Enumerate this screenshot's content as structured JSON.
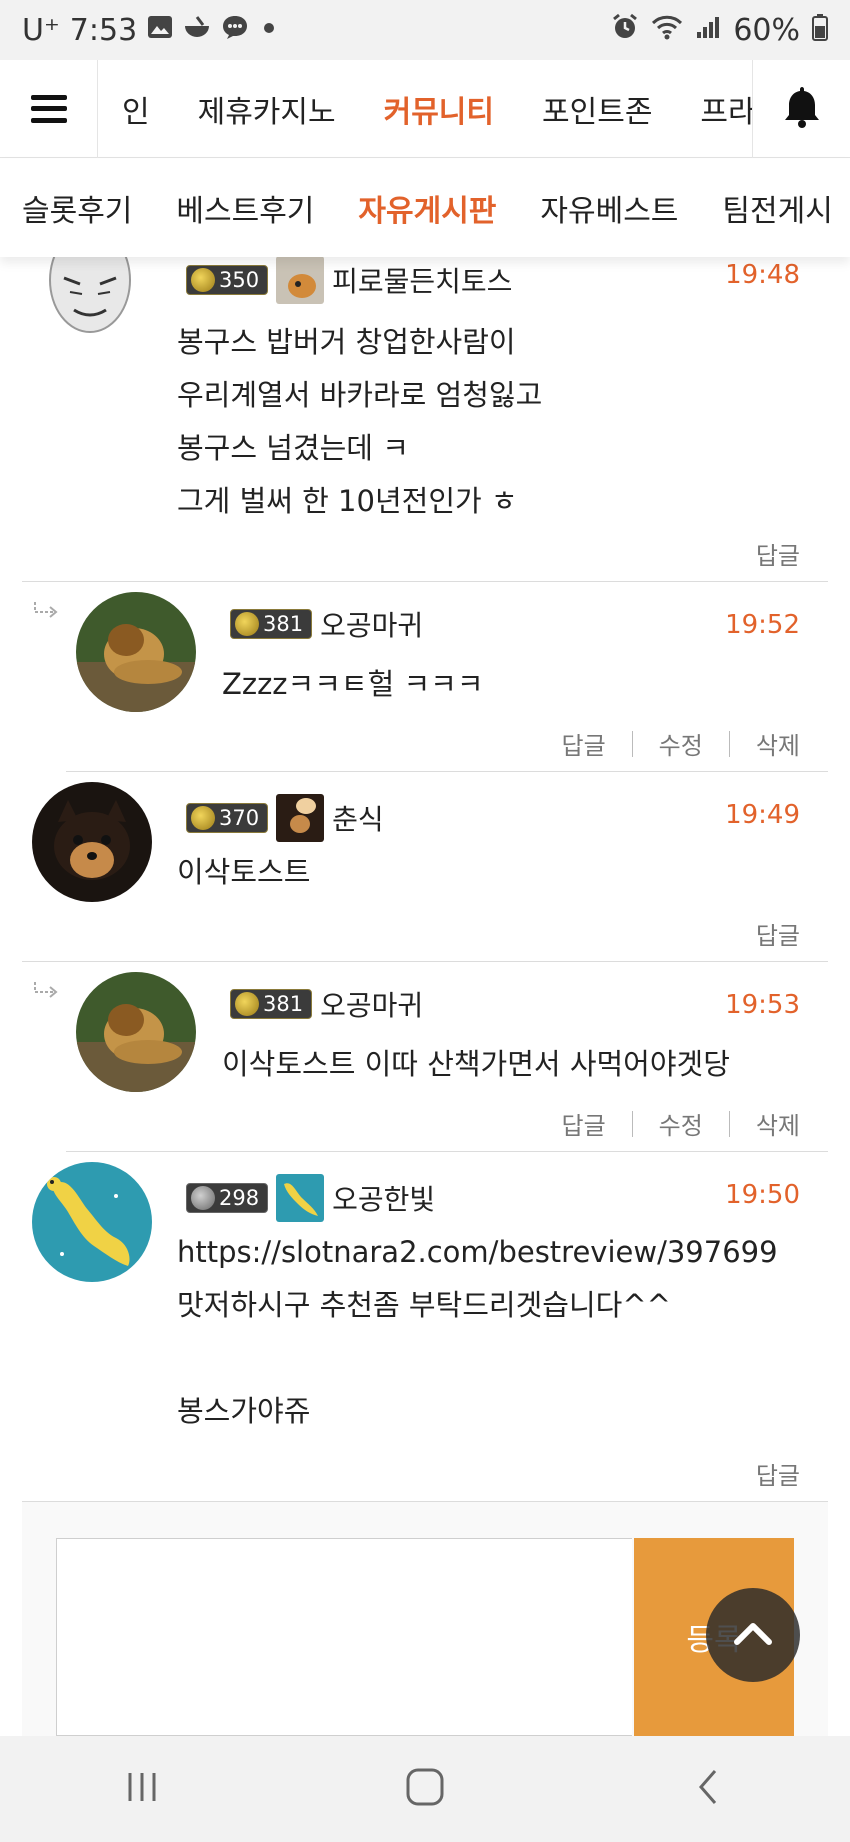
{
  "status_bar": {
    "carrier": "U⁺",
    "time": "7:53",
    "battery": "60%",
    "icons": [
      "gallery-icon",
      "bowl-icon",
      "chat-icon",
      "dot-icon",
      "alarm-icon",
      "wifi-icon",
      "signal-icon",
      "battery-icon"
    ]
  },
  "top_nav": {
    "tabs": [
      "인",
      "제휴카지노",
      "커뮤니티",
      "포인트존",
      "프라"
    ],
    "active_index": 2
  },
  "sub_nav": {
    "tabs": [
      "슬롯후기",
      "베스트후기",
      "자유게시판",
      "자유베스트",
      "팀전게시"
    ],
    "active_index": 2
  },
  "comments": [
    {
      "level": "350",
      "nickname": "피로물든치토스",
      "time": "19:48",
      "text": "봉구스 밥버거 창업한사람이\n우리계열서 바카라로 엄청잃고\n봉구스 넘겼는데 ㅋ\n그게 벌써 한 10년전인가 ㅎ",
      "actions": [
        "답글"
      ]
    },
    {
      "level": "381",
      "nickname": "오공마귀",
      "time": "19:52",
      "text": "Zzzzㅋㅋㅌ헐 ㅋㅋㅋ",
      "actions": [
        "답글",
        "수정",
        "삭제"
      ]
    },
    {
      "level": "370",
      "nickname": "춘식",
      "time": "19:49",
      "text": "이삭토스트",
      "actions": [
        "답글"
      ]
    },
    {
      "level": "381",
      "nickname": "오공마귀",
      "time": "19:53",
      "text": "이삭토스트 이따 산책가면서 사먹어야겟당",
      "actions": [
        "답글",
        "수정",
        "삭제"
      ]
    },
    {
      "level": "298",
      "nickname": "오공한빛",
      "time": "19:50",
      "text": "https://slotnara2.com/bestreview/397699\n맛저하시구  추천좀 부탁드리겟습니다^^\n\n봉스가야쥬",
      "actions": [
        "답글"
      ]
    }
  ],
  "composer": {
    "submit_label": "등록"
  },
  "colors": {
    "accent": "#e2622b",
    "submit": "#e79a3c"
  }
}
